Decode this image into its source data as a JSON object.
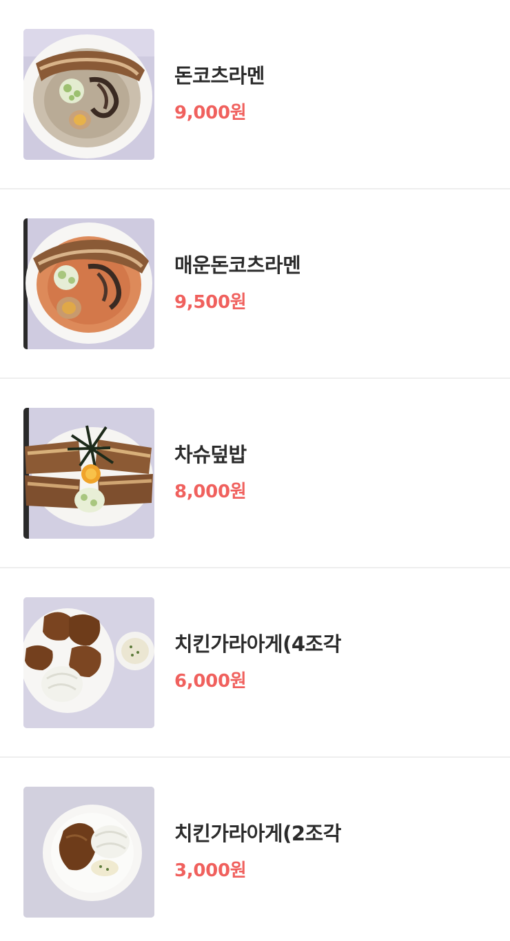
{
  "colors": {
    "price": "#f0605d",
    "name": "#2b2b2b",
    "divider": "#eeeeee"
  },
  "menu": {
    "items": [
      {
        "name": "돈코츠라멘",
        "price": "9,000원",
        "photo": "tonkotsu-ramen-photo"
      },
      {
        "name": "매운돈코츠라멘",
        "price": "9,500원",
        "photo": "spicy-tonkotsu-ramen-photo"
      },
      {
        "name": "차슈덮밥",
        "price": "8,000원",
        "photo": "chashu-rice-bowl-photo"
      },
      {
        "name": "치킨가라아게(4조각",
        "price": "6,000원",
        "photo": "chicken-karaage-4pc-photo"
      },
      {
        "name": "치킨가라아게(2조각",
        "price": "3,000원",
        "photo": "chicken-karaage-2pc-photo"
      }
    ]
  }
}
